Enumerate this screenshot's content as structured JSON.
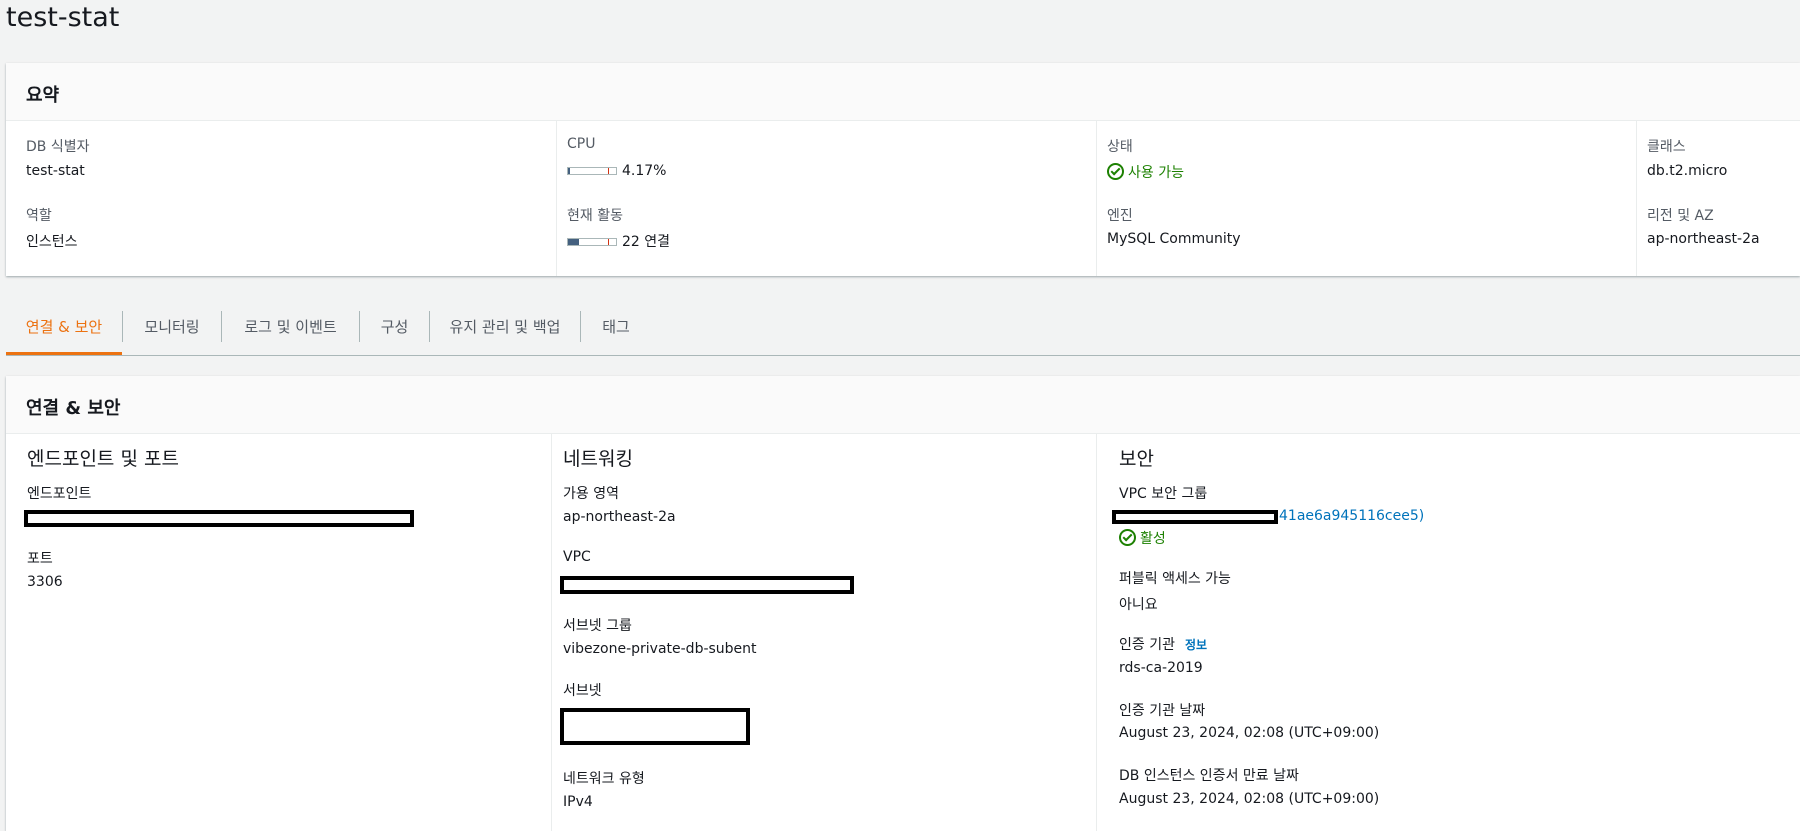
{
  "page_title": "test-stat",
  "summary": {
    "header": "요약",
    "db_identifier": {
      "label": "DB 식별자",
      "value": "test-stat"
    },
    "role": {
      "label": "역할",
      "value": "인스턴스"
    },
    "cpu": {
      "label": "CPU",
      "value": "4.17%",
      "fraction": 0.0417
    },
    "activity": {
      "label": "현재 활동",
      "value": "22 연결",
      "fraction": 0.22
    },
    "status": {
      "label": "상태",
      "value": "사용 가능",
      "icon": "check-circle-icon"
    },
    "engine": {
      "label": "엔진",
      "value": "MySQL Community"
    },
    "class": {
      "label": "클래스",
      "value": "db.t2.micro"
    },
    "region_az": {
      "label": "리전 및 AZ",
      "value": "ap-northeast-2a"
    }
  },
  "tabs": [
    {
      "label": "연결 & 보안",
      "active": true
    },
    {
      "label": "모니터링",
      "active": false
    },
    {
      "label": "로그 및 이벤트",
      "active": false
    },
    {
      "label": "구성",
      "active": false
    },
    {
      "label": "유지 관리 및 백업",
      "active": false
    },
    {
      "label": "태그",
      "active": false
    }
  ],
  "connectivity": {
    "header": "연결 & 보안",
    "endpoint_section": {
      "title": "엔드포인트 및 포트",
      "endpoint_label": "엔드포인트",
      "port_label": "포트",
      "port_value": "3306"
    },
    "networking": {
      "title": "네트워킹",
      "az_label": "가용 영역",
      "az_value": "ap-northeast-2a",
      "vpc_label": "VPC",
      "subnet_group_label": "서브넷 그룹",
      "subnet_group_value": "vibezone-private-db-subent",
      "subnets_label": "서브넷",
      "network_type_label": "네트워크 유형",
      "network_type_value": "IPv4"
    },
    "security": {
      "title": "보안",
      "vpc_sg_label": "VPC 보안 그룹",
      "vpc_sg_link_tail": "41ae6a945116cee5)",
      "vpc_sg_status": "활성",
      "public_access_label": "퍼블릭 액세스 가능",
      "public_access_value": "아니요",
      "ca_label": "인증 기관",
      "ca_info": "정보",
      "ca_value": "rds-ca-2019",
      "ca_date_label": "인증 기관 날짜",
      "ca_date_value": "August 23, 2024, 02:08 (UTC+09:00)",
      "cert_expiry_label": "DB 인스턴스 인증서 만료 날짜",
      "cert_expiry_value": "August 23, 2024, 02:08 (UTC+09:00)"
    }
  },
  "colors": {
    "accent": "#ec7211",
    "success": "#1d8102",
    "link": "#0073bb"
  }
}
